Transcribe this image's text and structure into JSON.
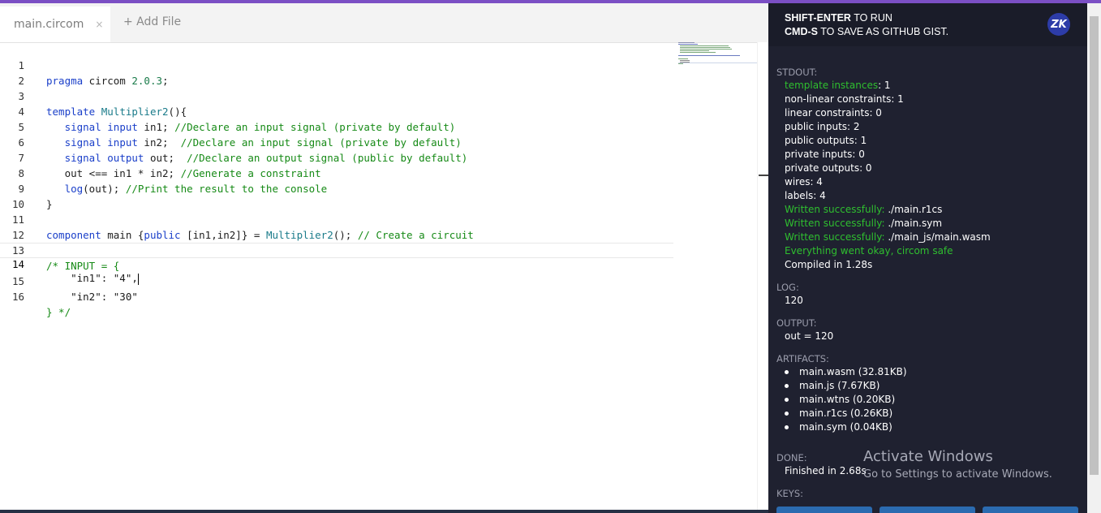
{
  "editor": {
    "tabs": [
      {
        "label": "main.circom",
        "close": "×"
      }
    ],
    "add_file_label": "+ Add File",
    "code_lines": [
      {
        "n": "1"
      },
      {
        "n": "2"
      },
      {
        "n": "3"
      },
      {
        "n": "4"
      },
      {
        "n": "5"
      },
      {
        "n": "6"
      },
      {
        "n": "7"
      },
      {
        "n": "8"
      },
      {
        "n": "9"
      },
      {
        "n": "10"
      },
      {
        "n": "11"
      },
      {
        "n": "12"
      },
      {
        "n": "13"
      },
      {
        "n": "14"
      },
      {
        "n": "15"
      },
      {
        "n": "16"
      }
    ],
    "code": {
      "l1_kw": "pragma",
      "l1_rest": " circom ",
      "l1_ver": "2.0.3",
      "l1_end": ";",
      "l3_kw": "template",
      "l3_name": "Multiplier2",
      "l3_end": "(){",
      "l4_a": "signal",
      "l4_b": "input",
      "l4_c": " in1; ",
      "l4_cm": "//Declare an input signal (private by default)",
      "l5_a": "signal",
      "l5_b": "input",
      "l5_c": " in2;  ",
      "l5_cm": "//Declare an input signal (private by default)",
      "l6_a": "signal",
      "l6_b": "output",
      "l6_c": " out;  ",
      "l6_cm": "//Declare an output signal (public by default)",
      "l7_c": "out <== in1 * in2; ",
      "l7_cm": "//Generate a constraint",
      "l8_fn": "log",
      "l8_c": "(out); ",
      "l8_cm": "//Print the result to the console",
      "l9": "}",
      "l11_kw": "component",
      "l11_a": " main {",
      "l11_kw2": "public",
      "l11_b": " [in1,in2]} = ",
      "l11_fn": "Multiplier2",
      "l11_c": "(); ",
      "l11_cm": "// Create a circuit",
      "l13_cm": "/* INPUT = {",
      "l14": "    \"in1\": \"4\",",
      "l15": "    \"in2\": \"30\"",
      "l16_cm": "} */"
    }
  },
  "output": {
    "hint1_key": "SHIFT-ENTER",
    "hint1_rest": " TO RUN",
    "hint2_key": "CMD-S",
    "hint2_rest": " TO SAVE AS GITHUB GIST.",
    "logo": "ZK",
    "stdout_label": "STDOUT:",
    "stdout": {
      "template_instances_label": "template instances",
      "template_instances_value": ": 1",
      "nonlinear": "non-linear constraints: 1",
      "linear": "linear constraints: 0",
      "public_inputs": "public inputs: 2",
      "public_outputs": "public outputs: 1",
      "private_inputs": "private inputs: 0",
      "private_outputs": "private outputs: 0",
      "wires": "wires: 4",
      "labels": "labels: 4",
      "written_label": "Written successfully:",
      "written1": " ./main.r1cs",
      "written2": " ./main.sym",
      "written3": " ./main_js/main.wasm",
      "okay": "Everything went okay, circom safe",
      "compiled": "Compiled in 1.28s"
    },
    "log_label": "LOG:",
    "log_value": "120",
    "output_label": "OUTPUT:",
    "output_value": "out = 120",
    "artifacts_label": "ARTIFACTS:",
    "artifacts": [
      "main.wasm (32.81KB)",
      "main.js (7.67KB)",
      "main.wtns (0.20KB)",
      "main.r1cs (0.26KB)",
      "main.sym (0.04KB)"
    ],
    "done_label": "DONE:",
    "done_value": "Finished in 2.68s",
    "keys_label": "KEYS:"
  },
  "watermark": {
    "title": "Activate Windows",
    "subtitle": "Go to Settings to activate Windows."
  },
  "colors": {
    "accent_top": "#7b4fc4",
    "panel_bg": "#1f2130",
    "success_green": "#2fbf2f",
    "keyword_blue": "#1a3fc9",
    "comment_green": "#168a16"
  }
}
